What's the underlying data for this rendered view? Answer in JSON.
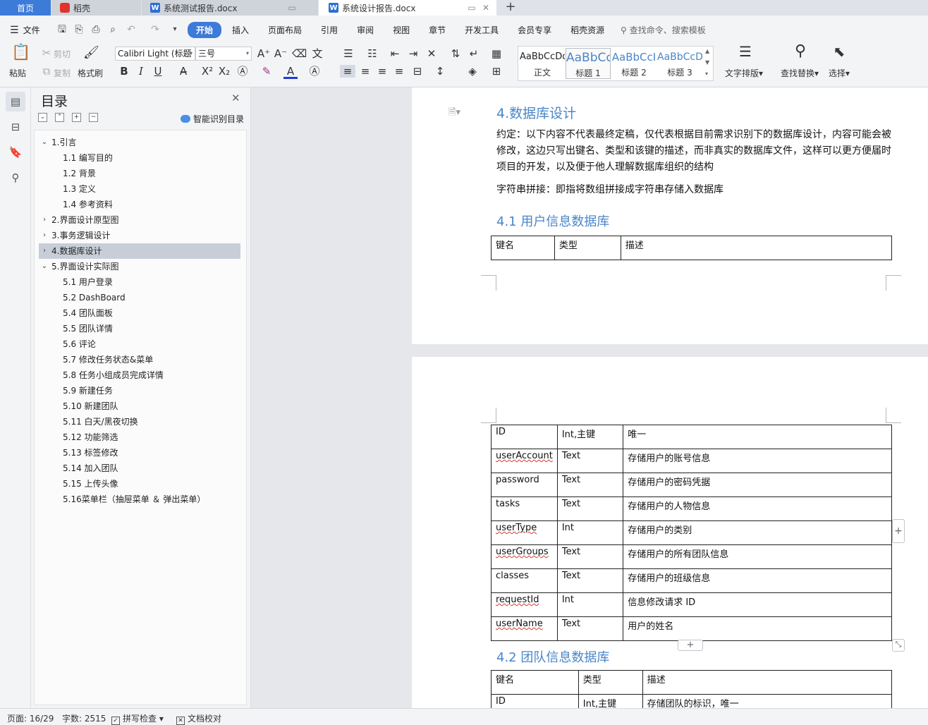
{
  "tabs": {
    "home": "首页",
    "docer": "稻壳",
    "doc1": "系统测试报告.docx",
    "doc2": "系统设计报告.docx",
    "add": "+"
  },
  "menu": {
    "file": "文件",
    "tabs": [
      "开始",
      "插入",
      "页面布局",
      "引用",
      "审阅",
      "视图",
      "章节",
      "开发工具",
      "会员专享",
      "稻壳资源"
    ],
    "active_tab": "开始",
    "search_placeholder": "查找命令、搜索模板"
  },
  "ribbon": {
    "paste": "粘贴",
    "cut": "剪切",
    "copy": "复制",
    "format_painter": "格式刷",
    "font_name": "Calibri Light (标题",
    "font_size": "三号",
    "styles": [
      {
        "sample": "AaBbCcDd",
        "name": "正文"
      },
      {
        "sample": "AaBbCc",
        "name": "标题 1"
      },
      {
        "sample": "AaBbCcI",
        "name": "标题 2"
      },
      {
        "sample": "AaBbCcDd",
        "name": "标题 3"
      }
    ],
    "text_layout": "文字排版",
    "find_replace": "查找替换",
    "select": "选择"
  },
  "toc": {
    "title": "目录",
    "smart": "智能识别目录",
    "items": [
      {
        "label": "1.引言",
        "level": 1,
        "expanded": true
      },
      {
        "label": "1.1 编写目的",
        "level": 2
      },
      {
        "label": "1.2  背景",
        "level": 2
      },
      {
        "label": "1.3 定义",
        "level": 2
      },
      {
        "label": "1.4    参考资料",
        "level": 2
      },
      {
        "label": "2.界面设计原型图",
        "level": 1,
        "expanded": false
      },
      {
        "label": "3.事务逻辑设计",
        "level": 1,
        "expanded": false
      },
      {
        "label": "4.数据库设计",
        "level": 1,
        "expanded": false,
        "selected": true
      },
      {
        "label": "5.界面设计实际图",
        "level": 1,
        "expanded": true
      },
      {
        "label": "5.1 用户登录",
        "level": 2
      },
      {
        "label": "5.2 DashBoard",
        "level": 2
      },
      {
        "label": "5.4  团队面板",
        "level": 2
      },
      {
        "label": "5.5  团队详情",
        "level": 2
      },
      {
        "label": "5.6  评论",
        "level": 2
      },
      {
        "label": "5.7  修改任务状态&菜单",
        "level": 2
      },
      {
        "label": "5.8  任务小组成员完成详情",
        "level": 2
      },
      {
        "label": "5.9  新建任务",
        "level": 2
      },
      {
        "label": "5.10  新建团队",
        "level": 2
      },
      {
        "label": "5.11  白天/黑夜切换",
        "level": 2
      },
      {
        "label": "5.12 功能筛选",
        "level": 2
      },
      {
        "label": "5.13  标签修改",
        "level": 2
      },
      {
        "label": "5.14  加入团队",
        "level": 2
      },
      {
        "label": "5.15  上传头像",
        "level": 2
      },
      {
        "label": "5.16菜单栏（抽屉菜单 ＆ 弹出菜单）",
        "level": 2
      }
    ]
  },
  "document": {
    "h4": "4.数据库设计",
    "para1": "约定：以下内容不代表最终定稿，仅代表根据目前需求识别下的数据库设计，内容可能会被修改，这边只写出键名、类型和该键的描述，而非真实的数据库文件，这样可以更方便届时项目的开发，以及便于他人理解数据库组织的结构",
    "para2": "字符串拼接：即指将数组拼接成字符串存储入数据库",
    "h41": "4.1 用户信息数据库",
    "table1_header": [
      "键名",
      "类型",
      "描述"
    ],
    "table1_rows": [
      [
        "ID",
        "Int,主键",
        "唯一"
      ],
      [
        "userAccount",
        "Text",
        "存储用户的账号信息"
      ],
      [
        "password",
        "Text",
        "存储用户的密码凭据"
      ],
      [
        "tasks",
        "Text",
        "存储用户的人物信息"
      ],
      [
        "userType",
        "Int",
        "存储用户的类别"
      ],
      [
        "userGroups",
        "Text",
        "存储用户的所有团队信息"
      ],
      [
        "classes",
        "Text",
        "存储用户的班级信息"
      ],
      [
        "requestId",
        "Int",
        "信息修改请求 ID"
      ],
      [
        "userName",
        "Text",
        "用户的姓名"
      ]
    ],
    "h42": "4.2 团队信息数据库",
    "table2_header": [
      "键名",
      "类型",
      "描述"
    ],
    "table2_rows": [
      [
        "ID",
        "Int,主键",
        "存储团队的标识，唯一"
      ]
    ]
  },
  "status": {
    "page": "页面: 16/29",
    "words": "字数: 2515",
    "spell": "拼写检查",
    "proof": "文档校对"
  },
  "colors": {
    "accent": "#3d7bd9",
    "heading": "#4a86c8"
  }
}
